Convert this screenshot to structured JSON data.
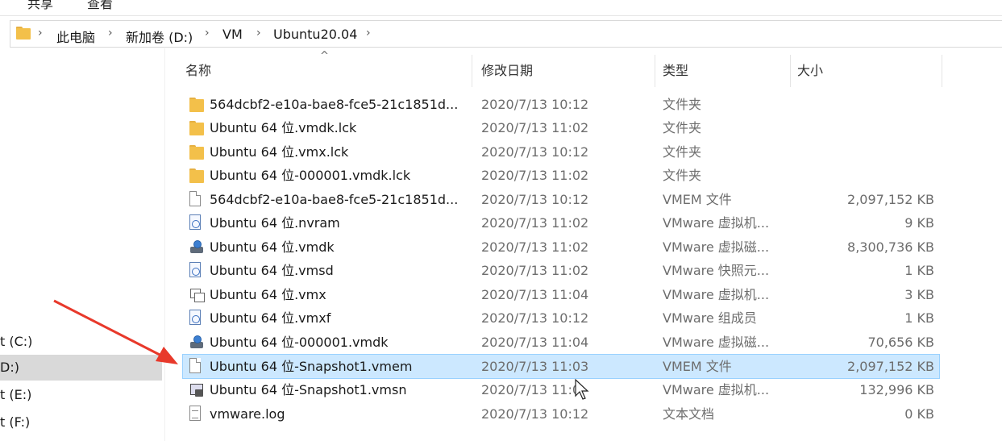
{
  "ribbon": {
    "tabs": [
      "共享",
      "查看"
    ]
  },
  "address": {
    "crumbs": [
      "此电脑",
      "新加卷 (D:)",
      "VM",
      "Ubuntu20.04"
    ]
  },
  "nav": {
    "items": [
      {
        "label": "t (C:)",
        "selected": false
      },
      {
        "label": "D:)",
        "selected": true
      },
      {
        "label": "t (E:)",
        "selected": false
      },
      {
        "label": "t (F:)",
        "selected": false
      }
    ]
  },
  "columns": {
    "name": "名称",
    "date": "修改日期",
    "type": "类型",
    "size": "大小"
  },
  "files": [
    {
      "icon": "folder-icon",
      "name": "564dcbf2-e10a-bae8-fce5-21c1851d...",
      "date": "2020/7/13 10:12",
      "type": "文件夹",
      "size": ""
    },
    {
      "icon": "folder-icon",
      "name": "Ubuntu 64 位.vmdk.lck",
      "date": "2020/7/13 11:02",
      "type": "文件夹",
      "size": ""
    },
    {
      "icon": "folder-icon",
      "name": "Ubuntu 64 位.vmx.lck",
      "date": "2020/7/13 10:12",
      "type": "文件夹",
      "size": ""
    },
    {
      "icon": "folder-icon",
      "name": "Ubuntu 64 位-000001.vmdk.lck",
      "date": "2020/7/13 11:02",
      "type": "文件夹",
      "size": ""
    },
    {
      "icon": "document-icon",
      "name": "564dcbf2-e10a-bae8-fce5-21c1851d...",
      "date": "2020/7/13 10:12",
      "type": "VMEM 文件",
      "size": "2,097,152 KB"
    },
    {
      "icon": "config-file-icon",
      "name": "Ubuntu 64 位.nvram",
      "date": "2020/7/13 11:02",
      "type": "VMware 虚拟机...",
      "size": "9 KB"
    },
    {
      "icon": "virtual-disk-icon",
      "name": "Ubuntu 64 位.vmdk",
      "date": "2020/7/13 11:02",
      "type": "VMware 虚拟磁...",
      "size": "8,300,736 KB"
    },
    {
      "icon": "config-file-icon",
      "name": "Ubuntu 64 位.vmsd",
      "date": "2020/7/13 11:02",
      "type": "VMware 快照元...",
      "size": "1 KB"
    },
    {
      "icon": "vm-config-icon",
      "name": "Ubuntu 64 位.vmx",
      "date": "2020/7/13 11:04",
      "type": "VMware 虚拟机...",
      "size": "3 KB"
    },
    {
      "icon": "config-file-icon",
      "name": "Ubuntu 64 位.vmxf",
      "date": "2020/7/13 10:12",
      "type": "VMware 组成员",
      "size": "1 KB"
    },
    {
      "icon": "virtual-disk-icon",
      "name": "Ubuntu 64 位-000001.vmdk",
      "date": "2020/7/13 11:04",
      "type": "VMware 虚拟磁...",
      "size": "70,656 KB"
    },
    {
      "icon": "document-icon",
      "name": "Ubuntu 64 位-Snapshot1.vmem",
      "date": "2020/7/13 11:03",
      "type": "VMEM 文件",
      "size": "2,097,152 KB",
      "selected": true
    },
    {
      "icon": "snapshot-icon",
      "name": "Ubuntu 64 位-Snapshot1.vmsn",
      "date": "2020/7/13 11:0",
      "type": "VMware 虚拟机...",
      "size": "132,996 KB"
    },
    {
      "icon": "text-document-icon",
      "name": "vmware.log",
      "date": "2020/7/13 10:12",
      "type": "文本文档",
      "size": "0 KB"
    }
  ],
  "colors": {
    "selection_bg": "#cce8ff",
    "selection_border": "#99d1ff",
    "annotation_arrow": "#e8392b",
    "folder": "#f3c04a"
  }
}
